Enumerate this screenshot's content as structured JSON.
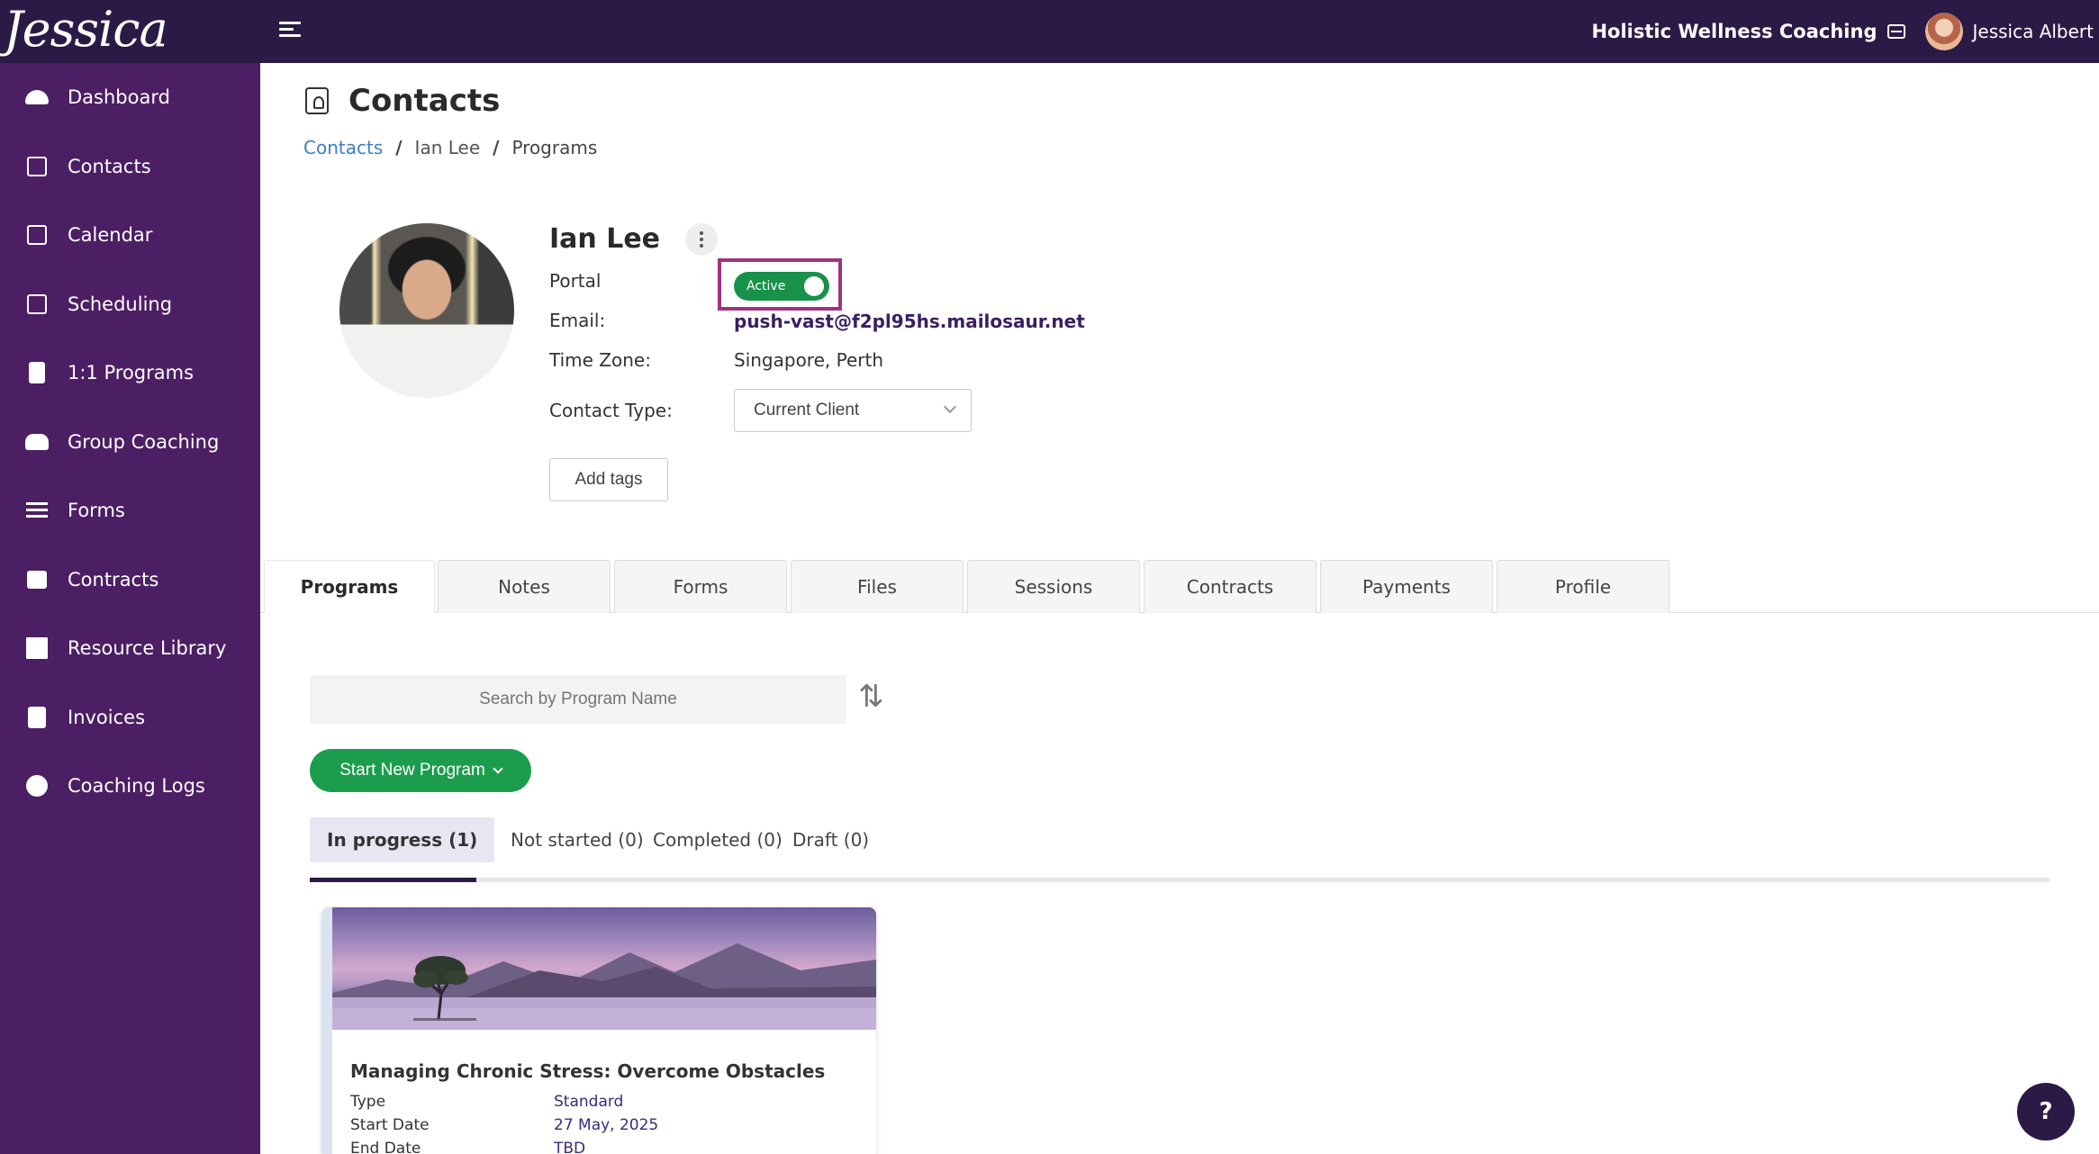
{
  "header": {
    "logo_text": "Jessica Albert",
    "business_name": "Holistic Wellness Coaching",
    "user_name": "Jessica Albert"
  },
  "sidebar": {
    "items": [
      {
        "label": "Dashboard",
        "icon": "dashboard-icon"
      },
      {
        "label": "Contacts",
        "icon": "contacts-icon"
      },
      {
        "label": "Calendar",
        "icon": "calendar-icon"
      },
      {
        "label": "Scheduling",
        "icon": "scheduling-icon"
      },
      {
        "label": "1:1 Programs",
        "icon": "book-icon"
      },
      {
        "label": "Group Coaching",
        "icon": "group-icon"
      },
      {
        "label": "Forms",
        "icon": "forms-icon"
      },
      {
        "label": "Contracts",
        "icon": "contract-sign-icon"
      },
      {
        "label": "Resource Library",
        "icon": "library-icon"
      },
      {
        "label": "Invoices",
        "icon": "invoice-icon"
      },
      {
        "label": "Coaching Logs",
        "icon": "clock-icon"
      }
    ]
  },
  "page": {
    "title": "Contacts",
    "breadcrumb": {
      "link": "Contacts",
      "sep": "/",
      "middle": "Ian Lee",
      "current": "Programs"
    }
  },
  "contact": {
    "name": "Ian Lee",
    "portal_label": "Portal",
    "portal_status": "Active",
    "email_label": "Email:",
    "email": "push-vast@f2pl95hs.mailosaur.net",
    "timezone_label": "Time Zone:",
    "timezone": "Singapore, Perth",
    "contact_type_label": "Contact Type:",
    "contact_type": "Current Client",
    "add_tags": "Add tags"
  },
  "tabs": [
    "Programs",
    "Notes",
    "Forms",
    "Files",
    "Sessions",
    "Contracts",
    "Payments",
    "Profile"
  ],
  "programs": {
    "search_placeholder": "Search by Program Name",
    "start_button": "Start New Program",
    "subtabs": [
      "In progress (1)",
      "Not started (0)",
      "Completed (0)",
      "Draft (0)"
    ],
    "card": {
      "title": "Managing Chronic Stress: Overcome Obstacles",
      "type_label": "Type",
      "type_value": "Standard",
      "start_label": "Start Date",
      "start_value": "27 May, 2025",
      "end_label": "End Date",
      "end_value": "TBD"
    }
  },
  "help": {
    "label": "?"
  },
  "colors": {
    "topbar": "#2b1a45",
    "sidebar": "#4c1e63",
    "toggle_active": "#18924a",
    "start_button": "#1c9d4e",
    "highlight_box": "#a1327f",
    "breadcrumb_link": "#3d7ec8"
  }
}
